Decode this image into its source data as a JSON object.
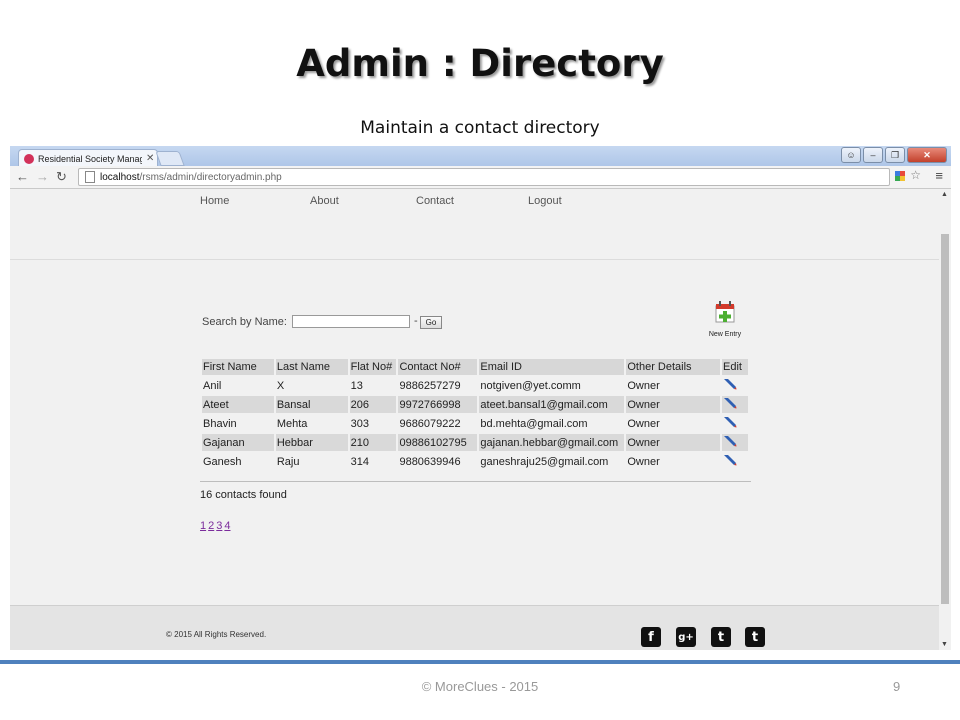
{
  "slide": {
    "title": "Admin : Directory",
    "subtitle": "Maintain a contact directory",
    "footer": "© MoreClues - 2015",
    "page_number": "9"
  },
  "browser": {
    "tab_title": "Residential Society Manag",
    "url_host": "localhost",
    "url_path": "/rsms/admin/directoryadmin.php"
  },
  "site": {
    "nav": [
      "Home",
      "About",
      "Contact",
      "Logout"
    ],
    "search_label": "Search by Name:",
    "search_value": "",
    "search_sep": "-",
    "go_label": "Go",
    "new_entry_label": "New Entry",
    "table": {
      "headers": [
        "First Name",
        "Last Name",
        "Flat No#",
        "Contact No#",
        "Email ID",
        "Other Details",
        "Edit"
      ],
      "rows": [
        [
          "Anil",
          "X",
          "13",
          "9886257279",
          "notgiven@yet.comm",
          "Owner"
        ],
        [
          "Ateet",
          "Bansal",
          "206",
          "9972766998",
          "ateet.bansal1@gmail.com",
          "Owner"
        ],
        [
          "Bhavin",
          "Mehta",
          "303",
          "9686079222",
          "bd.mehta@gmail.com",
          "Owner"
        ],
        [
          "Gajanan",
          "Hebbar",
          "210",
          "09886102795",
          "gajanan.hebbar@gmail.com",
          "Owner"
        ],
        [
          "Ganesh",
          "Raju",
          "314",
          "9880639946",
          "ganeshraju25@gmail.com",
          "Owner"
        ]
      ]
    },
    "count_text": "16 contacts found",
    "pages": [
      "1",
      "2",
      "3",
      "4"
    ],
    "footer_text": "© 2015 All Rights Reserved.",
    "social": [
      "f",
      "g+",
      "t",
      "t"
    ]
  },
  "colors": {
    "accent_rule": "#4f81bd",
    "table_header": "#d7d7d7",
    "link_visited": "#7b2c9c"
  }
}
